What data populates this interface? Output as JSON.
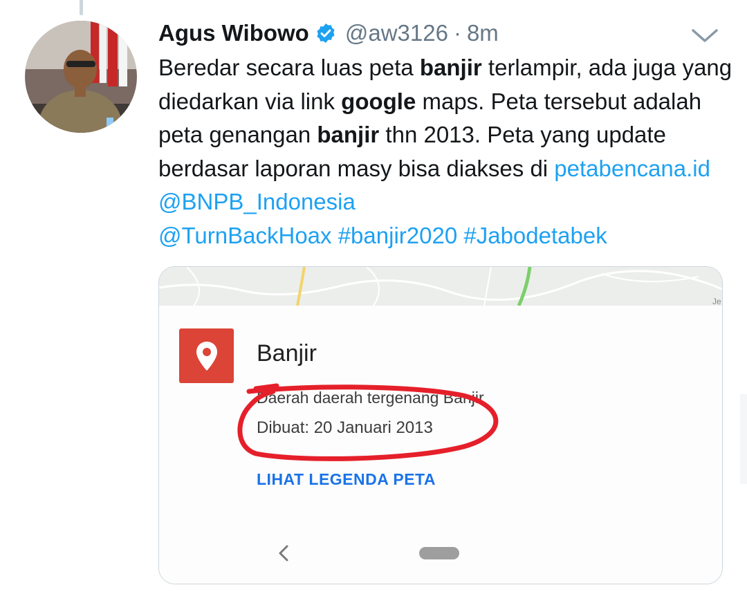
{
  "tweet": {
    "author": {
      "display_name": "Agus Wibowo",
      "handle": "@aw3126",
      "verified": true,
      "avatar_icon": "profile-photo"
    },
    "separator": "·",
    "time": "8m",
    "text_parts": [
      "Beredar secara luas peta ",
      "banjir",
      " terlampir, ada juga yang diedarkan via link ",
      "google",
      " maps. Peta tersebut adalah peta genangan ",
      "banjir",
      " thn 2013. Peta yang update berdasar laporan masy bisa diakses di ",
      "petabencana.id",
      " ",
      "@BNPB_Indonesia",
      " ",
      "@TurnBackHoax",
      " ",
      "#banjir2020",
      " ",
      "#Jabodetabek"
    ],
    "link_color": "#1da1f2",
    "more_icon": "chevron-down-icon"
  },
  "card": {
    "layer_title": "Banjir",
    "layer_description": "Daerah daerah tergenang Banjir",
    "created": "Dibuat: 20 Januari 2013",
    "legend_link": "LIHAT LEGENDA PETA",
    "pin_color": "#db4437",
    "annotation_color": "#e5202a",
    "icons": [
      "map-pin-icon",
      "back-chevron-icon",
      "home-pill-icon"
    ]
  }
}
